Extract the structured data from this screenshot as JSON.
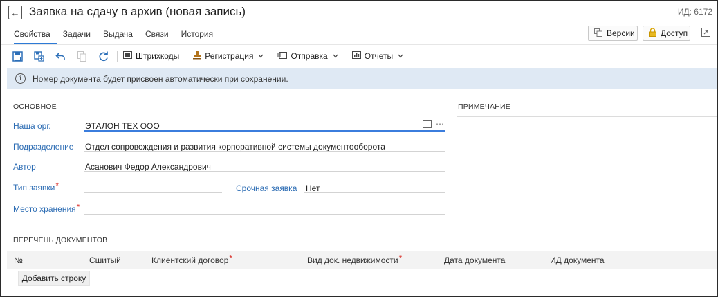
{
  "header": {
    "back_glyph": "←",
    "title": "Заявка на сдачу в архив (новая запись)",
    "doc_id": "ИД: 6172"
  },
  "tabs": [
    {
      "label": "Свойства",
      "active": true
    },
    {
      "label": "Задачи"
    },
    {
      "label": "Выдача"
    },
    {
      "label": "Связи"
    },
    {
      "label": "История"
    }
  ],
  "top_actions": {
    "versions": "Версии",
    "access": "Доступ"
  },
  "toolbar": {
    "barcodes": "Штрихкоды",
    "registration": "Регистрация",
    "sending": "Отправка",
    "reports": "Отчеты"
  },
  "banner": {
    "text": "Номер документа будет присвоен автоматически при сохранении."
  },
  "main_section": {
    "title": "ОСНОВНОЕ",
    "fields": {
      "org": {
        "label": "Наша орг.",
        "value": "ЭТАЛОН ТЕХ ООО"
      },
      "department": {
        "label": "Подразделение",
        "value": "Отдел сопровождения и развития корпоративной системы документооборота"
      },
      "author": {
        "label": "Автор",
        "value": "Асанович Федор Александрович"
      },
      "request_type": {
        "label": "Тип заявки",
        "required_mark": "*",
        "value": ""
      },
      "urgent": {
        "label": "Срочная заявка",
        "value": "Нет"
      },
      "storage": {
        "label": "Место хранения",
        "required_mark": "*",
        "value": ""
      }
    }
  },
  "note_section": {
    "title": "ПРИМЕЧАНИЕ"
  },
  "documents": {
    "title": "ПЕРЕЧЕНЬ ДОКУМЕНТОВ",
    "columns": {
      "num": "№",
      "stitched": "Сшитый",
      "client_contract": "Клиентский договор",
      "property_doc_type": "Вид док. недвижимости",
      "doc_date": "Дата документа",
      "doc_id": "ИД документа"
    },
    "required_mark": "*",
    "add_row": "Добавить строку"
  },
  "icons": {
    "accent": "#2c6fb8",
    "access_icon_color": "#d9a300",
    "link_label_color": "#2d6db4",
    "required_color": "#d9322b",
    "banner_bg": "#dfe9f4"
  }
}
